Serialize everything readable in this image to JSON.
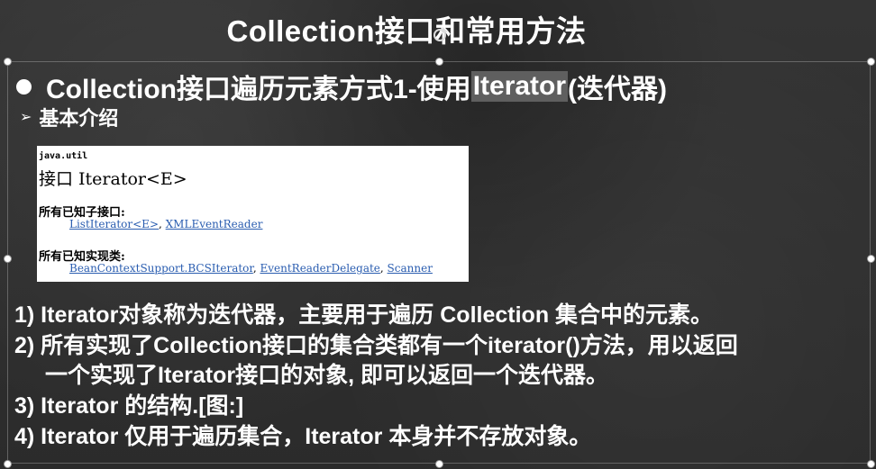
{
  "title": "Collection接口和常用方法",
  "bullet": {
    "before": "Collection接口遍历元素方式1-使用",
    "highlight": "Iterator",
    "after": "(迭代器)"
  },
  "subheading": {
    "arrow": "➢",
    "text": "基本介绍"
  },
  "doc": {
    "package": "java.util",
    "interface_name": "接口 Iterator<E>",
    "subinterfaces_heading": "所有已知子接口:",
    "subinterfaces": [
      "ListIterator<E>",
      "XMLEventReader"
    ],
    "impl_heading": "所有已知实现类:",
    "impl_classes": [
      "BeanContextSupport.BCSIterator",
      "EventReaderDelegate",
      "Scanner"
    ],
    "sep": ", "
  },
  "points": [
    "1) Iterator对象称为迭代器，主要用于遍历 Collection 集合中的元素。",
    "2) 所有实现了Collection接口的集合类都有一个iterator()方法，用以返回",
    "一个实现了Iterator接口的对象, 即可以返回一个迭代器。",
    "3) Iterator 的结构.[图:]",
    "4) Iterator 仅用于遍历集合，Iterator 本身并不存放对象。"
  ]
}
